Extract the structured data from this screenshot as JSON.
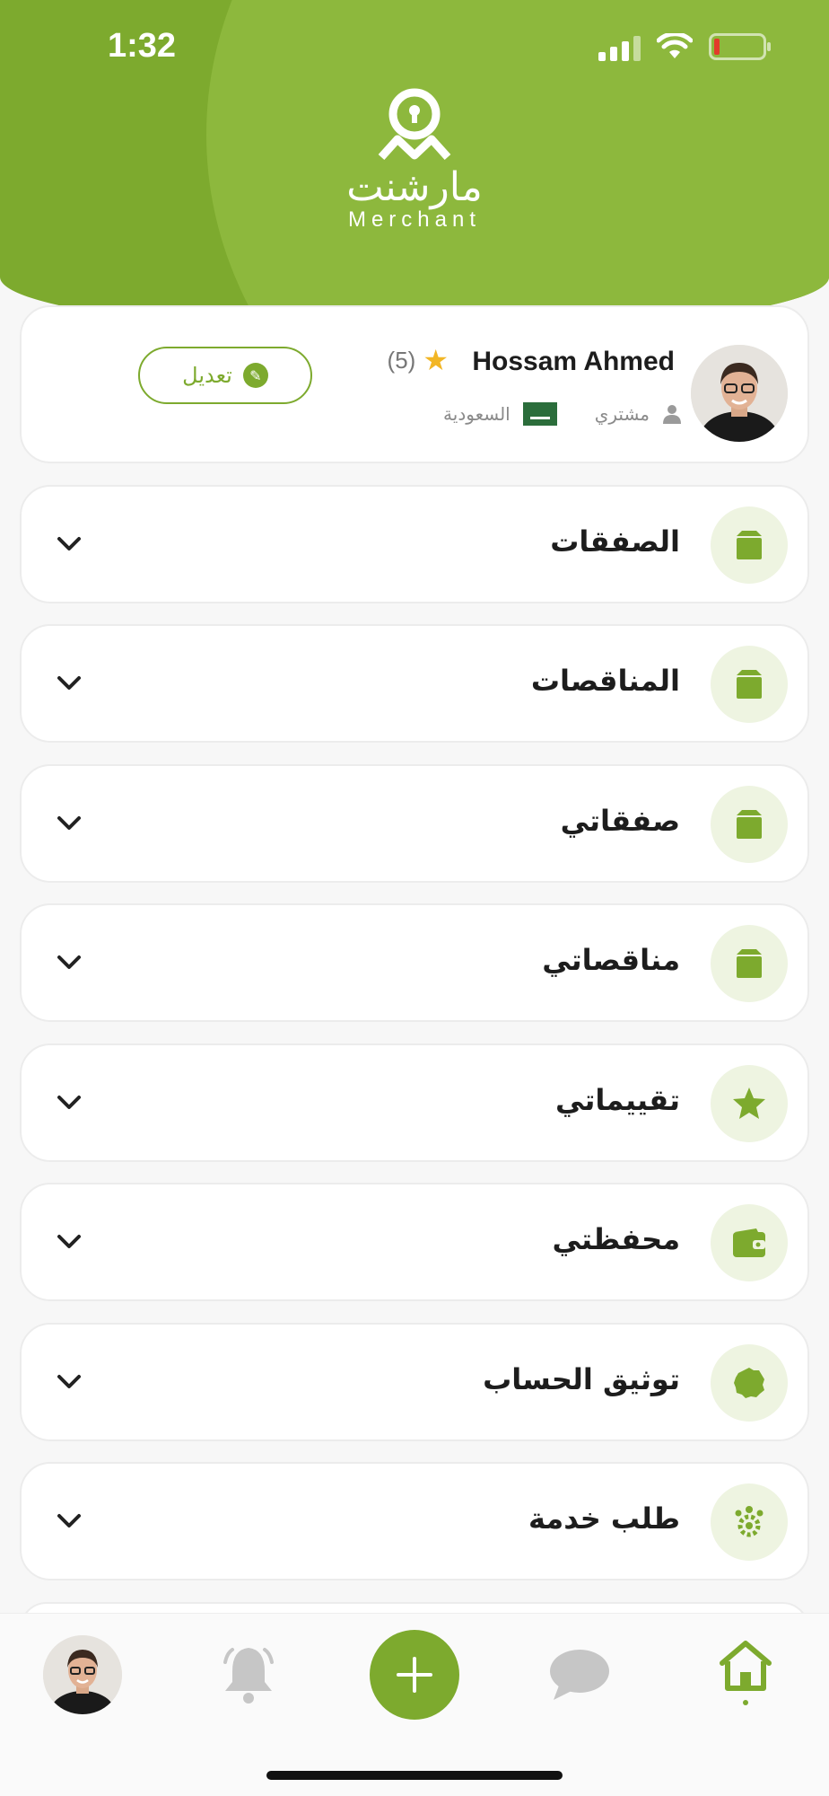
{
  "status_bar": {
    "time": "1:32"
  },
  "brand": {
    "name_ar": "مارشنت",
    "name_en": "Merchant"
  },
  "profile": {
    "name": "Hossam Ahmed",
    "rating": "(5)",
    "role": "مشتري",
    "country": "السعودية",
    "edit_label": "تعديل"
  },
  "menu": [
    {
      "label": "الصفقات",
      "icon": "box-icon"
    },
    {
      "label": "المناقصات",
      "icon": "box-icon"
    },
    {
      "label": "صفقاتي",
      "icon": "box-icon"
    },
    {
      "label": "مناقصاتي",
      "icon": "box-icon"
    },
    {
      "label": "تقييماتي",
      "icon": "star-icon"
    },
    {
      "label": "محفظتي",
      "icon": "wallet-icon"
    },
    {
      "label": "توثيق الحساب",
      "icon": "verified-badge-icon"
    },
    {
      "label": "طلب خدمة",
      "icon": "service-gear-icon"
    }
  ],
  "bottom_nav": [
    "profile-avatar",
    "notifications-bell-icon",
    "add-icon",
    "chat-icon",
    "home-icon"
  ],
  "colors": {
    "primary": "#7daa2e",
    "primary_light": "#eef4e1",
    "background": "#f7f7f7"
  }
}
